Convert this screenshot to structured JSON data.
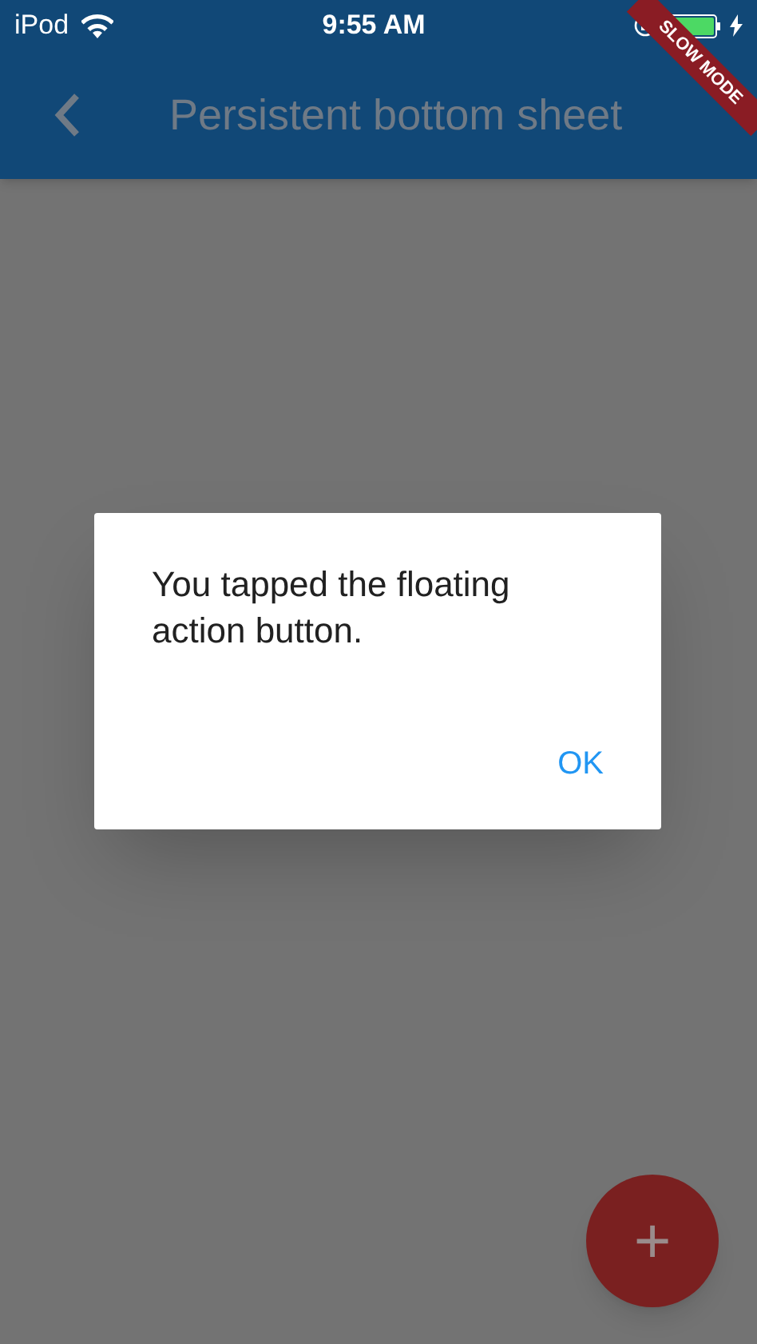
{
  "status_bar": {
    "carrier": "iPod",
    "time": "9:55 AM"
  },
  "banner": {
    "text": "SLOW MODE"
  },
  "app_bar": {
    "title": "Persistent bottom sheet"
  },
  "dialog": {
    "message": "You tapped the floating action button.",
    "buttons": [
      "OK"
    ]
  },
  "fab": {
    "label": "+"
  }
}
